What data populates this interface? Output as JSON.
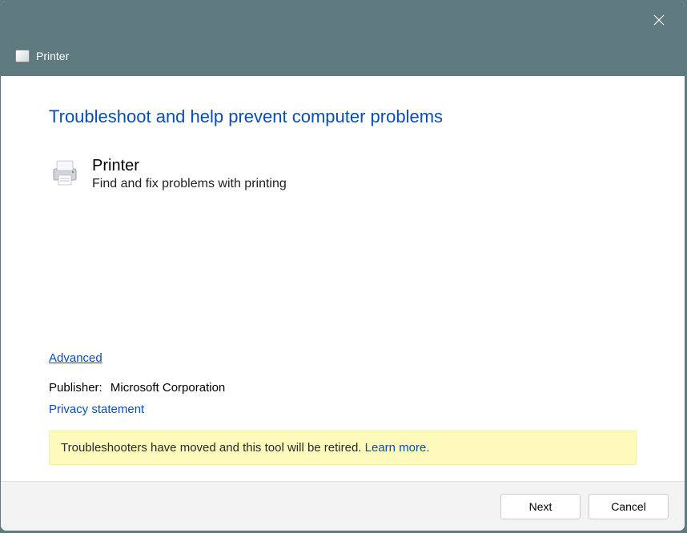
{
  "header": {
    "title": "Printer"
  },
  "main": {
    "heading": "Troubleshoot and help prevent computer problems",
    "item": {
      "title": "Printer",
      "description": "Find and fix problems with printing"
    },
    "advanced_label": "Advanced",
    "publisher_label": "Publisher:",
    "publisher_name": "Microsoft Corporation",
    "privacy_label": "Privacy statement",
    "notice_text": "Troubleshooters have moved and this tool will be retired. ",
    "notice_link": "Learn more."
  },
  "footer": {
    "next_label": "Next",
    "cancel_label": "Cancel"
  }
}
